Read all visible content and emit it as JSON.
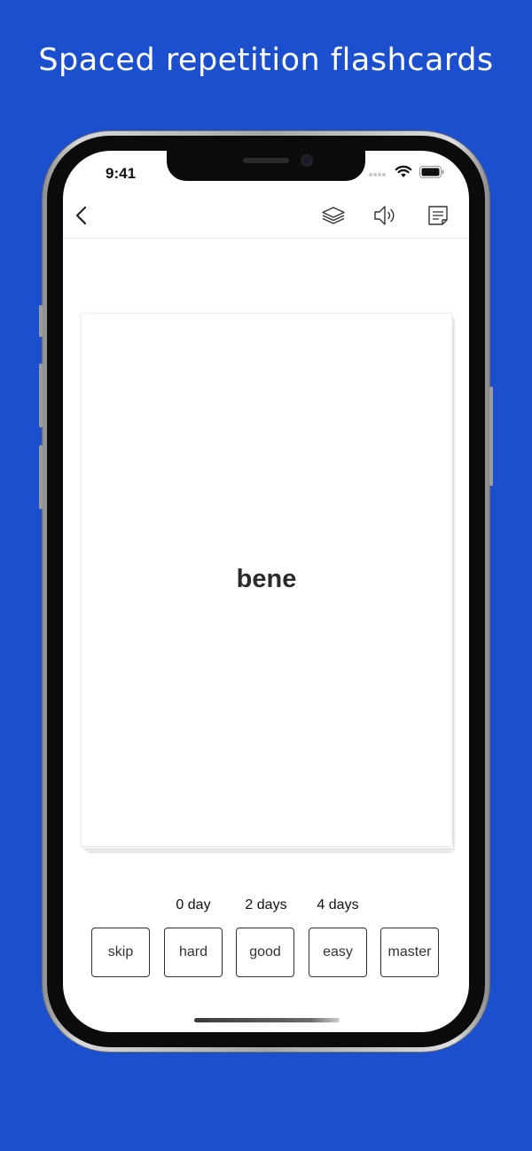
{
  "promo": {
    "headline": "Spaced repetition flashcards"
  },
  "status_bar": {
    "time": "9:41"
  },
  "nav": {
    "back_icon": "chevron-left-icon",
    "deck_icon": "layers-icon",
    "audio_icon": "speaker-icon",
    "notes_icon": "note-icon"
  },
  "card": {
    "front_text": "bene"
  },
  "intervals": {
    "hard": "0 day",
    "good": "2 days",
    "easy": "4 days"
  },
  "answers": {
    "skip": "skip",
    "hard": "hard",
    "good": "good",
    "easy": "easy",
    "master": "master"
  },
  "colors": {
    "background": "#1c4fce",
    "screen": "#ffffff",
    "text": "#2b2b2b"
  }
}
